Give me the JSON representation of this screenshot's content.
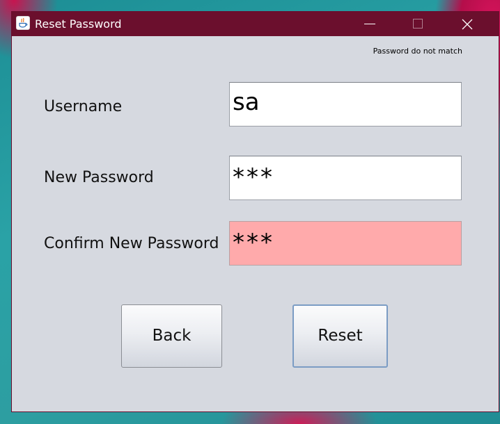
{
  "window": {
    "title": "Reset Password",
    "icons": {
      "app": "java-app-icon",
      "minimize": "minimize-icon",
      "maximize": "maximize-icon",
      "close": "close-icon"
    }
  },
  "status_message": "Password do not match",
  "form": {
    "username": {
      "label": "Username",
      "value": "sa"
    },
    "new_password": {
      "label": "New Password",
      "value": "***"
    },
    "confirm_password": {
      "label": "Confirm New Password",
      "value": "***",
      "error": true
    }
  },
  "buttons": {
    "back": "Back",
    "reset": "Reset"
  },
  "colors": {
    "titlebar": "#6b0f2d",
    "window_bg": "#d6d9e0",
    "error_field_bg": "#ffaaab",
    "focus_border": "#7b9cc4"
  }
}
